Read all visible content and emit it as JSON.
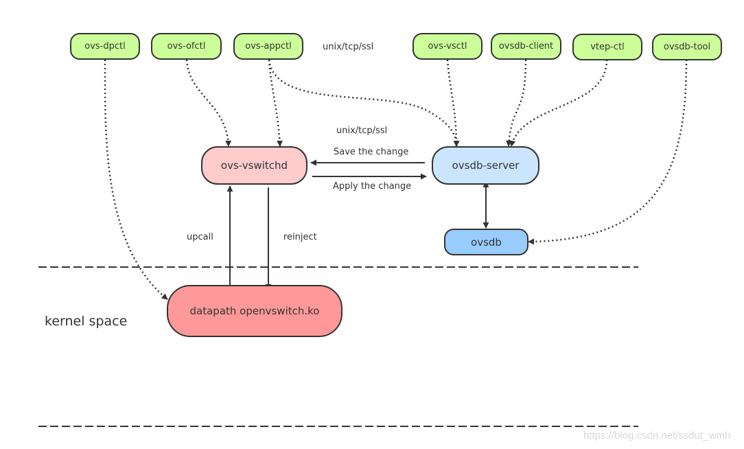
{
  "colors": {
    "tool_fill": "#ccff99",
    "vswitchd_fill": "#ffcccc",
    "server_fill": "#cce5ff",
    "ovsdb_fill": "#99ccff",
    "datapath_fill": "#ff9999",
    "stroke": "#333333"
  },
  "tools": [
    {
      "id": "ovs-dpctl",
      "label": "ovs-dpctl"
    },
    {
      "id": "ovs-ofctl",
      "label": "ovs-ofctl"
    },
    {
      "id": "ovs-appctl",
      "label": "ovs-appctl"
    },
    {
      "id": "ovs-vsctl",
      "label": "ovs-vsctl"
    },
    {
      "id": "ovsdb-client",
      "label": "ovsdb-client"
    },
    {
      "id": "vtep-ctl",
      "label": "vtep-ctl"
    },
    {
      "id": "ovsdb-tool",
      "label": "ovsdb-tool"
    }
  ],
  "nodes": {
    "vswitchd": "ovs-vswitchd",
    "server": "ovsdb-server",
    "ovsdb": "ovsdb",
    "datapath": "datapath openvswitch.ko"
  },
  "labels": {
    "protocol_top": "unix/tcp/ssl",
    "protocol_mid": "unix/tcp/ssl",
    "save_change": "Save the change",
    "apply_change": "Apply the change",
    "upcall": "upcall",
    "reinject": "reinject",
    "kernel_space": "kernel space"
  },
  "edges": [
    {
      "from": "ovs-dpctl",
      "to": "datapath",
      "style": "dotted"
    },
    {
      "from": "ovs-ofctl",
      "to": "vswitchd",
      "style": "dotted"
    },
    {
      "from": "ovs-appctl",
      "to": "vswitchd",
      "style": "dotted"
    },
    {
      "from": "ovs-appctl",
      "to": "server",
      "style": "dotted"
    },
    {
      "from": "ovs-vsctl",
      "to": "server",
      "style": "dotted"
    },
    {
      "from": "ovsdb-client",
      "to": "server",
      "style": "dotted"
    },
    {
      "from": "vtep-ctl",
      "to": "server",
      "style": "dotted"
    },
    {
      "from": "ovsdb-tool",
      "to": "ovsdb",
      "style": "dotted"
    },
    {
      "from": "server",
      "to": "vswitchd",
      "style": "solid",
      "label": "Save the change"
    },
    {
      "from": "vswitchd",
      "to": "server",
      "style": "solid",
      "label": "Apply the change"
    },
    {
      "from": "server",
      "to": "ovsdb",
      "style": "solid",
      "bidirectional": true
    },
    {
      "from": "datapath",
      "to": "vswitchd",
      "style": "solid",
      "label": "upcall"
    },
    {
      "from": "vswitchd",
      "to": "datapath",
      "style": "solid",
      "label": "reinject"
    }
  ],
  "watermark": "https://blog.csdn.net/ssdut_wmh"
}
